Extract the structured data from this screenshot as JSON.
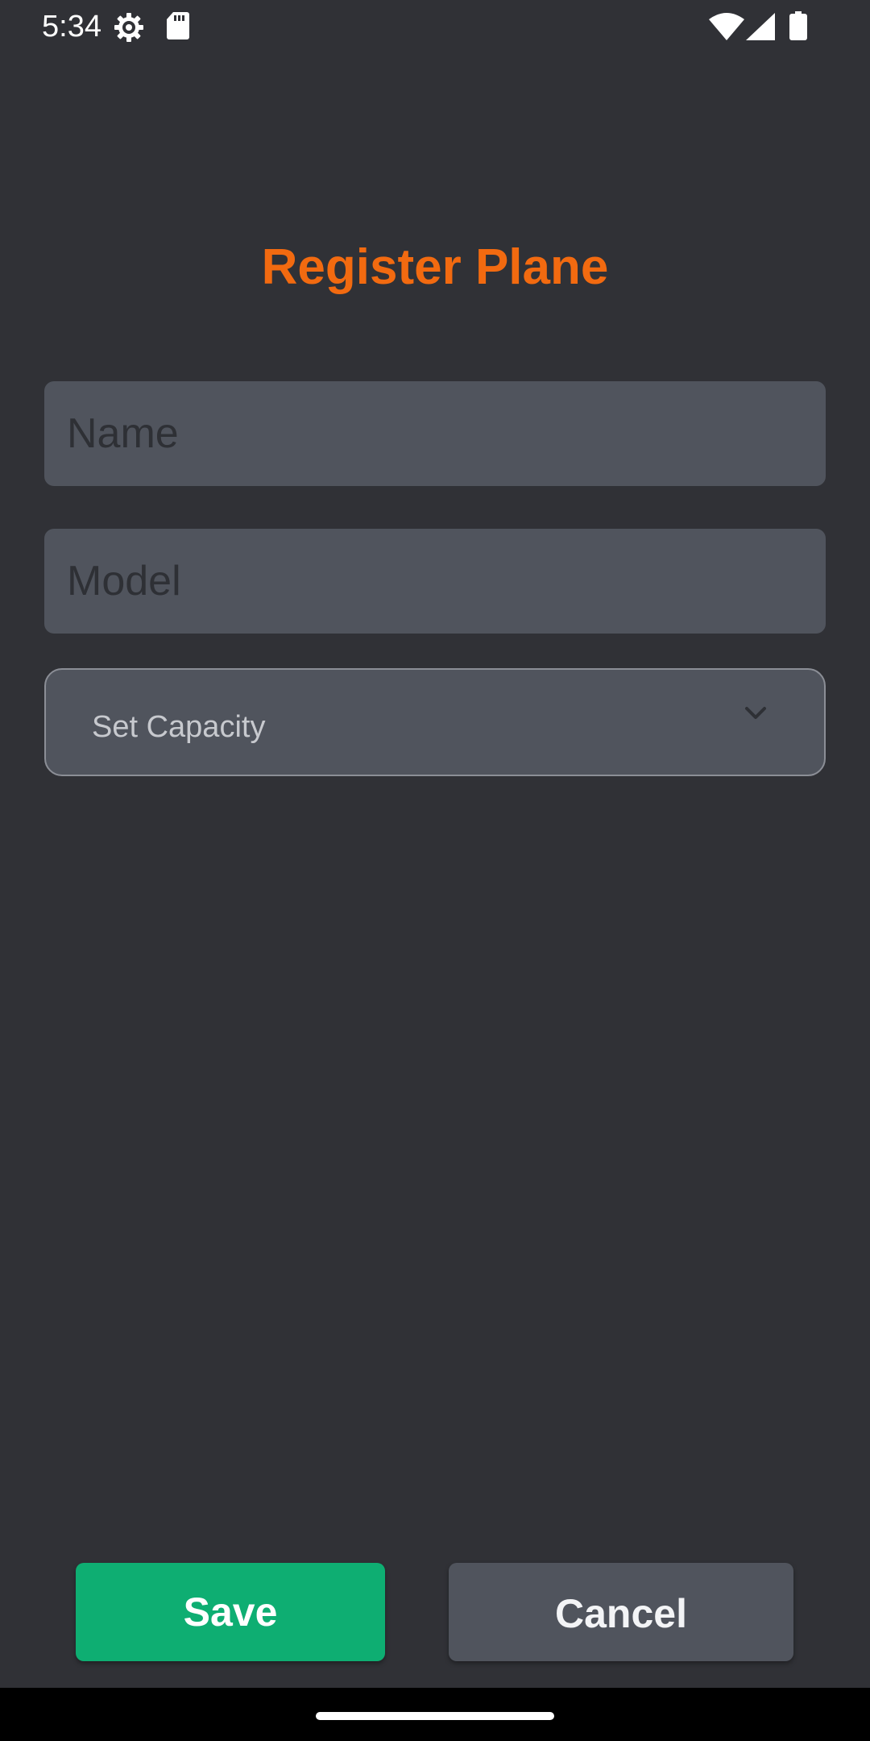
{
  "status_bar": {
    "time": "5:34",
    "icons": [
      "gear-icon",
      "sd-card-icon",
      "wifi-icon",
      "cell-signal-icon",
      "battery-icon"
    ]
  },
  "page": {
    "title": "Register Plane",
    "title_color": "#f26a10"
  },
  "form": {
    "name": {
      "value": "",
      "placeholder": "Name"
    },
    "model": {
      "value": "",
      "placeholder": "Model"
    },
    "capacity": {
      "label": "Set Capacity",
      "icon": "chevron-down-icon"
    }
  },
  "actions": {
    "save_label": "Save",
    "cancel_label": "Cancel",
    "save_color": "#0eae72"
  },
  "theme": {
    "background": "#303136",
    "field_background": "#50545d"
  }
}
